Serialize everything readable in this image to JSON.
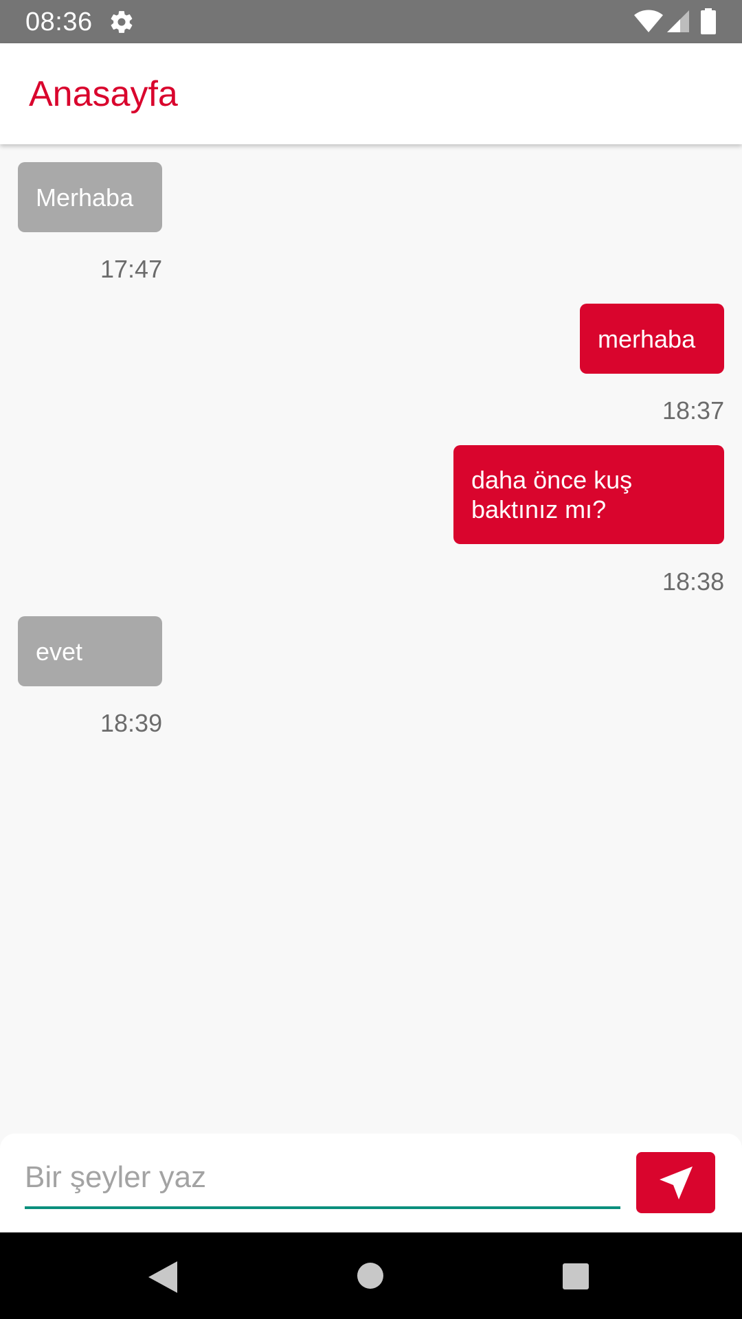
{
  "status_bar": {
    "time": "08:36",
    "icons": [
      "gear-icon",
      "wifi-icon",
      "cell-signal-icon",
      "battery-icon"
    ]
  },
  "app_bar": {
    "title": "Anasayfa"
  },
  "messages": [
    {
      "direction": "incoming",
      "text": "Merhaba",
      "time": "17:47"
    },
    {
      "direction": "outgoing",
      "text": "merhaba",
      "time": "18:37"
    },
    {
      "direction": "outgoing",
      "text": "daha önce kuş baktınız mı?",
      "time": "18:38"
    },
    {
      "direction": "incoming",
      "text": "evet",
      "time": "18:39"
    }
  ],
  "composer": {
    "value": "",
    "placeholder": "Bir şeyler yaz",
    "send_icon": "send-icon"
  },
  "nav_bar": {
    "icons": [
      "back-icon",
      "home-icon",
      "recents-icon"
    ]
  },
  "colors": {
    "accent": "#d9052d",
    "incoming_bubble": "#a9a9a9",
    "input_underline": "#0b8f7d",
    "status_bar": "#757575"
  }
}
